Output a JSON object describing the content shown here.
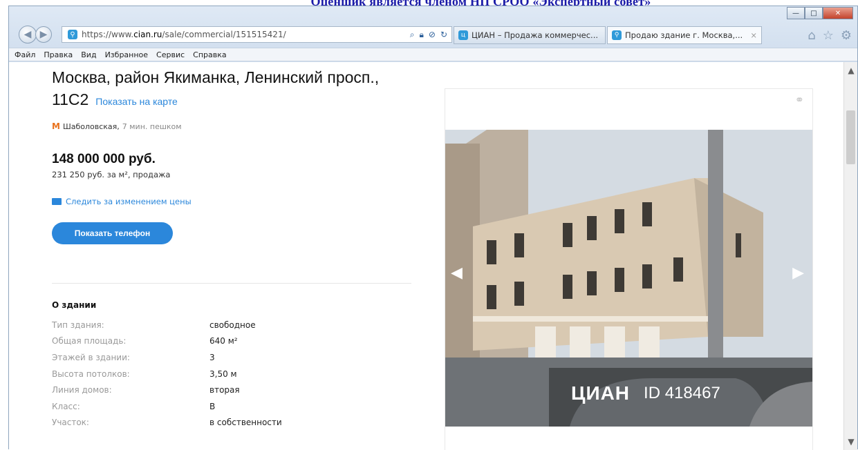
{
  "document": {
    "caption": "Оценщик является членом НП СРОО «Экспертный совет»"
  },
  "browser": {
    "address_url_prefix": "https://www.",
    "address_url_domain": "cian.ru",
    "address_url_path": "/sale/commercial/151515421/",
    "tabs": [
      {
        "label": "ЦИАН – Продажа коммерчес..."
      },
      {
        "label": "Продаю здание г. Москва,..."
      }
    ],
    "menu": [
      "Файл",
      "Правка",
      "Вид",
      "Избранное",
      "Сервис",
      "Справка"
    ]
  },
  "listing": {
    "address_line": "Москва, район Якиманка, Ленинский просп., 11С2",
    "map_link": "Показать на карте",
    "metro_station": "Шаболовская,",
    "metro_walk": "7 мин. пешком",
    "price": "148 000 000 руб.",
    "price_details": "231 250 руб. за м², продажа",
    "follow_price": "Следить за изменением цены",
    "show_phone": "Показать телефон"
  },
  "building": {
    "section_title": "О здании",
    "rows": [
      {
        "label": "Тип здания:",
        "value": "свободное"
      },
      {
        "label": "Общая площадь:",
        "value": "640 м²"
      },
      {
        "label": "Этажей в здании:",
        "value": "3"
      },
      {
        "label": "Высота потолков:",
        "value": "3,50 м"
      },
      {
        "label": "Линия домов:",
        "value": "вторая"
      },
      {
        "label": "Класс:",
        "value": "B"
      },
      {
        "label": "Участок:",
        "value": "в собственности"
      }
    ]
  },
  "photo": {
    "watermark_logo": "ЦИАН",
    "watermark_id": "ID 418467"
  },
  "icons": {
    "back": "back-arrow-icon",
    "forward": "forward-arrow-icon",
    "search": "search-icon",
    "lock": "lock-icon",
    "refresh": "refresh-icon",
    "home": "home-icon",
    "star": "favorites-star-icon",
    "gear": "gear-icon",
    "metro": "metro-icon",
    "mail": "mail-icon",
    "share": "share-icon"
  },
  "colors": {
    "accent": "#2b87db",
    "metro": "#e8711c",
    "caption": "#1a1aa8"
  }
}
